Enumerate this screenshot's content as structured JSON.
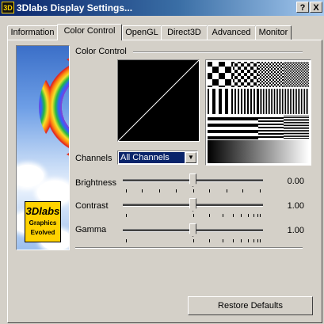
{
  "window": {
    "title": "3Dlabs Display Settings...",
    "icon_text": "3D",
    "help_label": "?",
    "close_label": "X"
  },
  "tabs": [
    {
      "label": "Information",
      "active": false
    },
    {
      "label": "Color Control",
      "active": true
    },
    {
      "label": "OpenGL",
      "active": false
    },
    {
      "label": "Direct3D",
      "active": false
    },
    {
      "label": "Advanced",
      "active": false
    },
    {
      "label": "Monitor",
      "active": false
    }
  ],
  "banner": {
    "logo_main": "3Dlabs",
    "logo_sub_1": "Graphics",
    "logo_sub_2": "Evolved"
  },
  "color_control": {
    "group_label": "Color Control",
    "channels_label": "Channels",
    "channels_value": "All Channels",
    "sliders": [
      {
        "label": "Brightness",
        "value": "0.00",
        "level": 0.5
      },
      {
        "label": "Contrast",
        "value": "1.00",
        "level": 0.5
      },
      {
        "label": "Gamma",
        "value": "1.00",
        "level": 0.5
      }
    ]
  },
  "buttons": {
    "restore_defaults": "Restore Defaults"
  },
  "colors": {
    "face": "#d4d0c8",
    "title_start": "#0a246a",
    "title_end": "#a6caf0",
    "logo": "#ffd200",
    "selection": "#0a246a"
  }
}
